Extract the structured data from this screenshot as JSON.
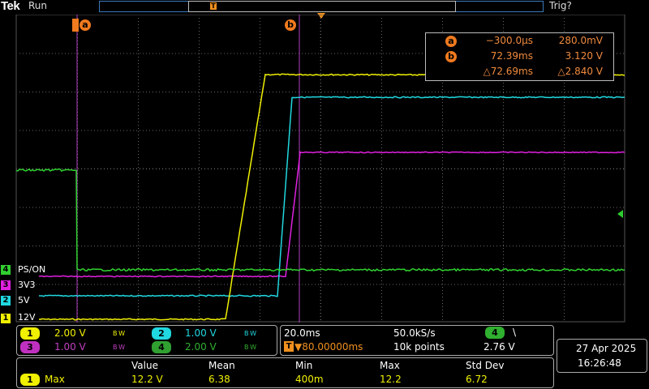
{
  "header": {
    "brand": "Tek",
    "status": "Run",
    "trigger_status": "Trig?",
    "record_marker": "T"
  },
  "colors": {
    "ch1": "#f0f000",
    "ch2": "#20d8e0",
    "ch3": "#e020e0",
    "ch4": "#30d030",
    "cursor": "#f07a1e",
    "frame": "#aaaaaa"
  },
  "cursors": {
    "a_label": "a",
    "b_label": "b",
    "a_time": "−300.0µs",
    "a_volt": "280.0mV",
    "b_time": "72.39ms",
    "b_volt": "3.120 V",
    "delta_time": "△72.69ms",
    "delta_volt": "△2.840 V"
  },
  "channels": [
    {
      "id": "4",
      "name": "PS/ON",
      "color": "#30d030"
    },
    {
      "id": "3",
      "name": "3V3",
      "color": "#e020e0"
    },
    {
      "id": "2",
      "name": "5V",
      "color": "#20d8e0"
    },
    {
      "id": "1",
      "name": "12V",
      "color": "#f0f000"
    }
  ],
  "vertical": {
    "ch1_num": "1",
    "ch1_scale": "2.00 V",
    "ch2_num": "2",
    "ch2_scale": "1.00 V",
    "ch3_num": "3",
    "ch3_scale": "1.00 V",
    "ch4_num": "4",
    "ch4_scale": "2.00 V",
    "bw": "B W"
  },
  "horizontal": {
    "timebase": "20.0ms",
    "sample_rate": "50.0kS/s",
    "delay": "▼80.00000ms",
    "record_length": "10k points",
    "trigger_source": "4",
    "trigger_slope": "\\",
    "trigger_level": "2.76 V",
    "delay_icon": "T→"
  },
  "datetime": {
    "date": "27 Apr  2025",
    "time": "16:26:48"
  },
  "measurement": {
    "headers": [
      "Value",
      "Mean",
      "Min",
      "Max",
      "Std Dev"
    ],
    "source": "1",
    "type": "Max",
    "values": [
      "12.2 V",
      "6.38",
      "400m",
      "12.2",
      "6.72"
    ]
  }
}
